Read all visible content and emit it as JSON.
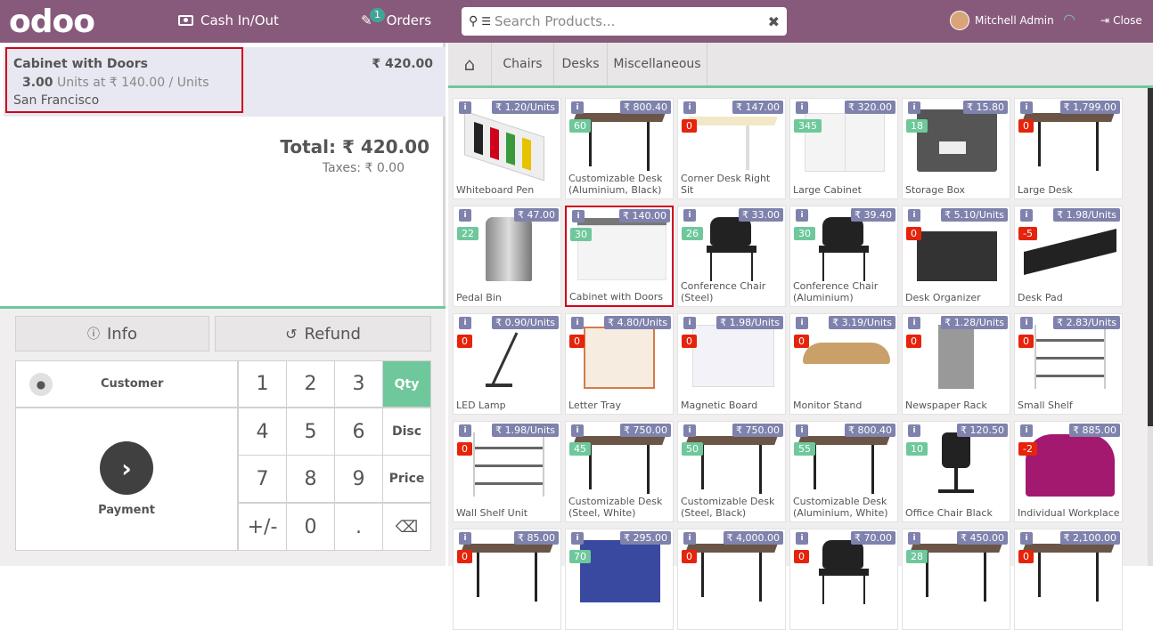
{
  "header": {
    "logo": "odoo",
    "cash": "Cash In/Out",
    "orders": "Orders",
    "orders_count": "1",
    "search_placeholder": "Search Products...",
    "user": "Mitchell Admin",
    "close": "Close"
  },
  "order": {
    "line": {
      "name": "Cabinet with Doors",
      "price": "₹ 420.00",
      "qty": "3.00",
      "unit_text": "Units at ₹ 140.00 / Units",
      "note": "San Francisco"
    },
    "total": "Total: ₹ 420.00",
    "taxes": "Taxes: ₹ 0.00"
  },
  "controls": {
    "info": "Info",
    "refund": "Refund",
    "customer": "Customer",
    "payment": "Payment",
    "keys": [
      "1",
      "2",
      "3",
      "4",
      "5",
      "6",
      "7",
      "8",
      "9",
      "+/-",
      "0",
      "."
    ],
    "modes": [
      "Qty",
      "Disc",
      "Price"
    ]
  },
  "categories": [
    "Chairs",
    "Desks",
    "Miscellaneous"
  ],
  "products": [
    {
      "name": "Whiteboard Pen",
      "price": "₹ 1.20/Units",
      "stock": "",
      "img": "pen"
    },
    {
      "name": "Customizable Desk (Aluminium, Black)",
      "price": "₹ 800.40",
      "stock": "60",
      "img": "desk"
    },
    {
      "name": "Corner Desk Right Sit",
      "price": "₹ 147.00",
      "stock": "0",
      "img": "cdesk"
    },
    {
      "name": "Large Cabinet",
      "price": "₹ 320.00",
      "stock": "345",
      "img": "cabinet"
    },
    {
      "name": "Storage Box",
      "price": "₹ 15.80",
      "stock": "18",
      "img": "box"
    },
    {
      "name": "Large Desk",
      "price": "₹ 1,799.00",
      "stock": "0",
      "img": "desk"
    },
    {
      "name": "Pedal Bin",
      "price": "₹ 47.00",
      "stock": "22",
      "img": "bin"
    },
    {
      "name": "Cabinet with Doors",
      "price": "₹ 140.00",
      "stock": "30",
      "img": "cabdoor"
    },
    {
      "name": "Conference Chair (Steel)",
      "price": "₹ 33.00",
      "stock": "26",
      "img": "chair"
    },
    {
      "name": "Conference Chair (Aluminium)",
      "price": "₹ 39.40",
      "stock": "30",
      "img": "chair"
    },
    {
      "name": "Desk Organizer",
      "price": "₹ 5.10/Units",
      "stock": "0",
      "img": "org"
    },
    {
      "name": "Desk Pad",
      "price": "₹ 1.98/Units",
      "stock": "-5",
      "img": "pad"
    },
    {
      "name": "LED Lamp",
      "price": "₹ 0.90/Units",
      "stock": "0",
      "img": "lamp"
    },
    {
      "name": "Letter Tray",
      "price": "₹ 4.80/Units",
      "stock": "0",
      "img": "tray"
    },
    {
      "name": "Magnetic Board",
      "price": "₹ 1.98/Units",
      "stock": "0",
      "img": "board"
    },
    {
      "name": "Monitor Stand",
      "price": "₹ 3.19/Units",
      "stock": "0",
      "img": "stand"
    },
    {
      "name": "Newspaper Rack",
      "price": "₹ 1.28/Units",
      "stock": "0",
      "img": "rack"
    },
    {
      "name": "Small Shelf",
      "price": "₹ 2.83/Units",
      "stock": "0",
      "img": "shelf"
    },
    {
      "name": "Wall Shelf Unit",
      "price": "₹ 1.98/Units",
      "stock": "0",
      "img": "shelf"
    },
    {
      "name": "Customizable Desk (Steel, White)",
      "price": "₹ 750.00",
      "stock": "45",
      "img": "desk"
    },
    {
      "name": "Customizable Desk (Steel, Black)",
      "price": "₹ 750.00",
      "stock": "50",
      "img": "desk"
    },
    {
      "name": "Customizable Desk (Aluminium, White)",
      "price": "₹ 800.40",
      "stock": "55",
      "img": "desk"
    },
    {
      "name": "Office Chair Black",
      "price": "₹ 120.50",
      "stock": "10",
      "img": "ochair"
    },
    {
      "name": "Individual Workplace",
      "price": "₹ 885.00",
      "stock": "-2",
      "img": "booth"
    },
    {
      "name": "",
      "price": "₹ 85.00",
      "stock": "0",
      "img": "desk"
    },
    {
      "name": "",
      "price": "₹ 295.00",
      "stock": "70",
      "img": "panel"
    },
    {
      "name": "",
      "price": "₹ 4,000.00",
      "stock": "0",
      "img": "desk"
    },
    {
      "name": "",
      "price": "₹ 70.00",
      "stock": "0",
      "img": "chair"
    },
    {
      "name": "",
      "price": "₹ 450.00",
      "stock": "28",
      "img": "desk"
    },
    {
      "name": "",
      "price": "₹ 2,100.00",
      "stock": "0",
      "img": "desk"
    }
  ]
}
